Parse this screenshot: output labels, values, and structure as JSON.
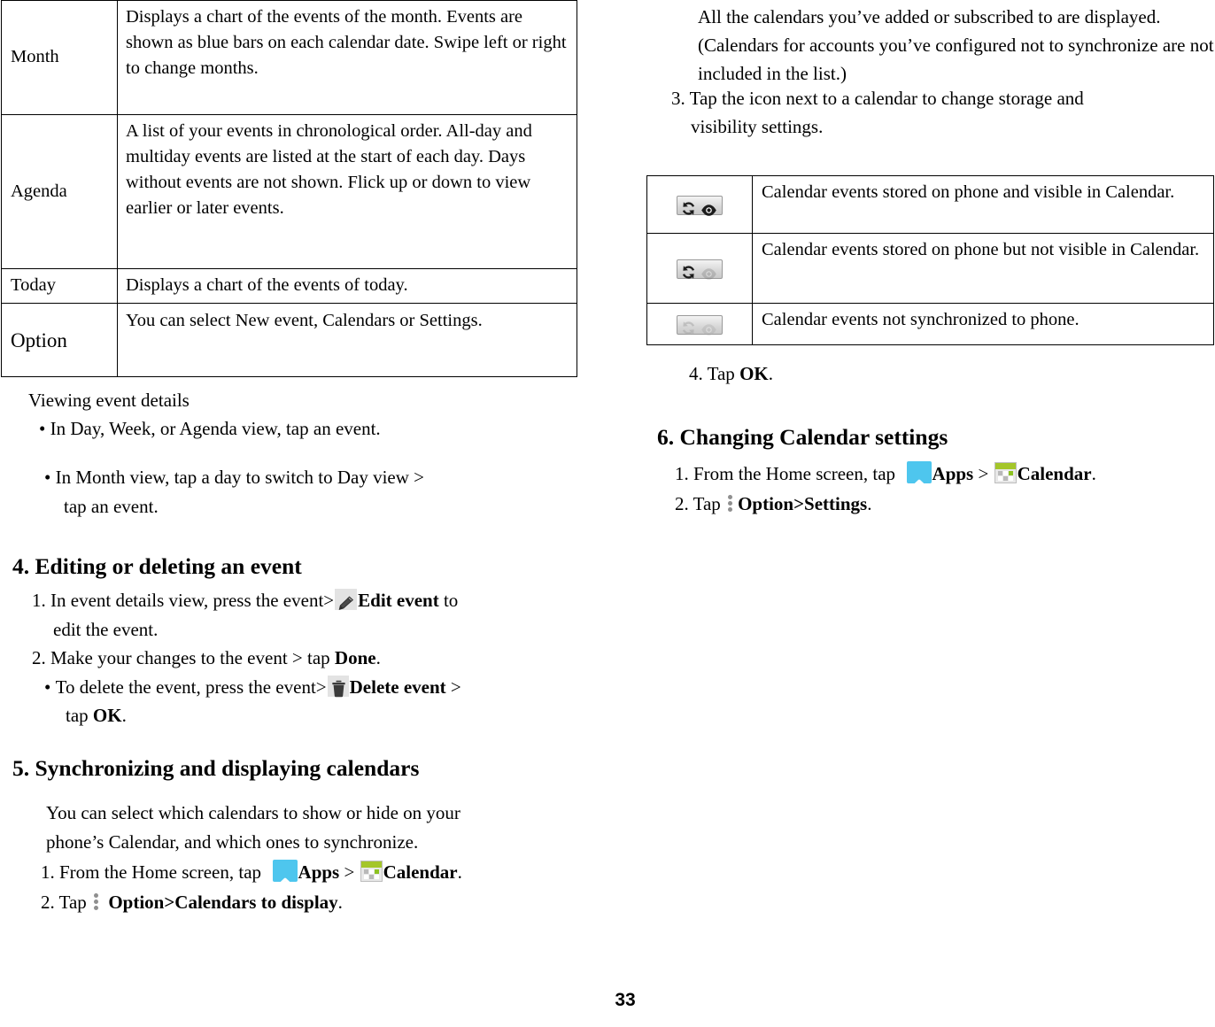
{
  "page": {
    "number": "33"
  },
  "views_table": {
    "rows": [
      {
        "label": "Month",
        "description": "Displays a chart of the events of the month. Events are shown as blue bars on each calendar date. Swipe left or right to change months."
      },
      {
        "label": "Agenda",
        "description": "A list of your events in chronological order. All-day and multiday events are listed at the start of each day. Days without events are not shown. Flick up or down to view earlier or later events."
      },
      {
        "label": "Today",
        "description": "Displays a chart of the events of today."
      },
      {
        "label": "Option",
        "icon": "three-dots-icon",
        "description": "You can select New event, Calendars or Settings."
      }
    ]
  },
  "viewing_event_details": {
    "heading": "Viewing event details",
    "bullet_1": "In Day, Week, or Agenda view, tap an event.",
    "bullet_2_line_1": "In Month view, tap a day to switch to Day view >",
    "bullet_2_line_2": "tap an event."
  },
  "section_4": {
    "heading": "4. Editing or deleting an event",
    "step_1": {
      "number": "1.",
      "text_before": "In event details view, press the event>",
      "icon": "pencil-icon",
      "bold_label": "Edit event",
      "text_after": " to",
      "continuation": "edit the event."
    },
    "step_2": {
      "number": "2.",
      "text_before": "Make your changes to the event > tap ",
      "bold_label": "Done",
      "text_after": "."
    },
    "bullet": {
      "text_before": "To delete the event, press the event>",
      "icon": "trash-icon",
      "bold_label": "Delete event",
      "text_after": " >",
      "continuation_before": "tap ",
      "continuation_bold": "OK",
      "continuation_after": "."
    }
  },
  "section_5": {
    "heading": "5. Synchronizing and displaying calendars",
    "intro_line_1": "You can select which calendars to show or hide on your",
    "intro_line_2": "phone’s Calendar, and which ones to synchronize.",
    "step_1": {
      "number": "1.",
      "text_before": "From the Home screen, tap ",
      "apps_icon": "apps-icon",
      "apps_label": "Apps",
      "separator": " > ",
      "calendar_icon": "calendar-icon",
      "calendar_label": "Calendar",
      "text_after": "."
    },
    "step_2": {
      "number": "2.",
      "text_before": "Tap ",
      "option_icon": "three-dots-icon",
      "bold_label": "Option>Calendars to display",
      "text_after": "."
    }
  },
  "right_column": {
    "paragraph": "All the calendars you’ve added or subscribed to are displayed. (Calendars for accounts you’ve configured not to synchronize are not included in the list.)",
    "step_3": {
      "number": "3.",
      "line_1": "Tap the icon next to a calendar to change storage and",
      "line_2": "visibility settings."
    },
    "step_4": {
      "number": "4.",
      "text_before": "Tap ",
      "bold_label": "OK",
      "text_after": "."
    }
  },
  "sync_table": {
    "rows": [
      {
        "icon": "sync-visible-icon",
        "icon_state": "sync-on-eye-on",
        "description": "Calendar events stored on phone and visible in Calendar."
      },
      {
        "icon": "sync-hidden-icon",
        "icon_state": "sync-on-eye-off",
        "description": "Calendar events stored on phone but not visible in Calendar."
      },
      {
        "icon": "sync-off-icon",
        "icon_state": "sync-off-eye-off",
        "description": "Calendar events not synchronized to phone."
      }
    ]
  },
  "section_6": {
    "heading": "6. Changing Calendar settings",
    "step_1": {
      "number": "1.",
      "text_before": "From the Home screen, tap ",
      "apps_icon": "apps-icon",
      "apps_label": "Apps",
      "separator": " > ",
      "calendar_icon": "calendar-icon",
      "calendar_label": "Calendar",
      "text_after": "."
    },
    "step_2": {
      "number": "2.",
      "text_before": "Tap ",
      "option_icon": "three-dots-icon",
      "bold_label": "Option>Settings",
      "text_after": "."
    }
  },
  "colors": {
    "apps_icon_bg": "#4ec6ee",
    "calendar_icon_accent": "#a4c62a",
    "icon_button_bg": "#d9d9d9"
  }
}
